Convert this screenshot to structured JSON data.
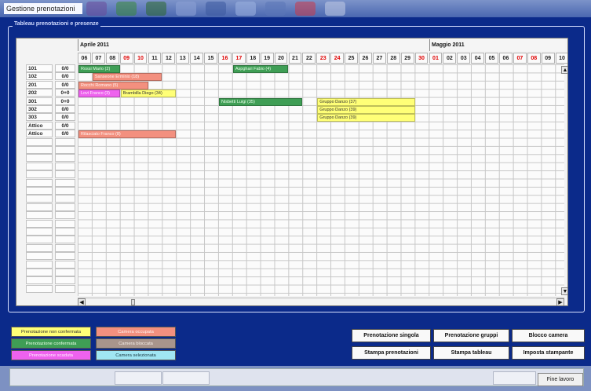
{
  "window": {
    "title": "Gestione prenotazioni"
  },
  "group": {
    "label": "Tableau prenotazioni e presenze"
  },
  "months": [
    {
      "label": "Aprile 2011"
    },
    {
      "label": "Maggio 2011"
    }
  ],
  "days": [
    {
      "n": "06",
      "red": false
    },
    {
      "n": "07",
      "red": false
    },
    {
      "n": "08",
      "red": false
    },
    {
      "n": "09",
      "red": true
    },
    {
      "n": "10",
      "red": true
    },
    {
      "n": "11",
      "red": false
    },
    {
      "n": "12",
      "red": false
    },
    {
      "n": "13",
      "red": false
    },
    {
      "n": "14",
      "red": false
    },
    {
      "n": "15",
      "red": false
    },
    {
      "n": "16",
      "red": true
    },
    {
      "n": "17",
      "red": true
    },
    {
      "n": "18",
      "red": false
    },
    {
      "n": "19",
      "red": false
    },
    {
      "n": "20",
      "red": false
    },
    {
      "n": "21",
      "red": false
    },
    {
      "n": "22",
      "red": false
    },
    {
      "n": "23",
      "red": true
    },
    {
      "n": "24",
      "red": true
    },
    {
      "n": "25",
      "red": false
    },
    {
      "n": "26",
      "red": false
    },
    {
      "n": "27",
      "red": false
    },
    {
      "n": "28",
      "red": false
    },
    {
      "n": "29",
      "red": false
    },
    {
      "n": "30",
      "red": true
    },
    {
      "n": "01",
      "red": true
    },
    {
      "n": "02",
      "red": false
    },
    {
      "n": "03",
      "red": false
    },
    {
      "n": "04",
      "red": false
    },
    {
      "n": "05",
      "red": false
    },
    {
      "n": "06",
      "red": false
    },
    {
      "n": "07",
      "red": true
    },
    {
      "n": "08",
      "red": true
    },
    {
      "n": "09",
      "red": false
    },
    {
      "n": "10",
      "red": false
    }
  ],
  "rooms": [
    {
      "name": "101",
      "status": "0/0"
    },
    {
      "name": "102",
      "status": "0/0"
    },
    {
      "name": "201",
      "status": "0/0"
    },
    {
      "name": "202",
      "status": "0+0"
    },
    {
      "name": "301",
      "status": "0+0"
    },
    {
      "name": "302",
      "status": "0/0"
    },
    {
      "name": "303",
      "status": "0/0"
    },
    {
      "name": "Attico",
      "status": "0/0"
    },
    {
      "name": "Attico",
      "status": "0/0"
    }
  ],
  "bookings": [
    {
      "label": "Rossi Mario (2)",
      "color": "green",
      "row": 0,
      "start": 0,
      "len": 3
    },
    {
      "label": "Aspghari Fabio (4)",
      "color": "green",
      "row": 0,
      "start": 11,
      "len": 4
    },
    {
      "label": "Sanseone Erminio (18)",
      "color": "salmon",
      "row": 1,
      "start": 1,
      "len": 5
    },
    {
      "label": "Rocchi Romano (5)",
      "color": "salmon",
      "row": 2,
      "start": 0,
      "len": 5
    },
    {
      "label": "Lovi Franco (3)",
      "color": "magenta",
      "row": 3,
      "start": 0,
      "len": 3
    },
    {
      "label": "Brambilla Diego (34)",
      "color": "yellow",
      "row": 3,
      "start": 3,
      "len": 4
    },
    {
      "label": "Nisbetti Luigi (35)",
      "color": "green",
      "row": 4,
      "start": 10,
      "len": 6
    },
    {
      "label": "Gruppo Danzo (37)",
      "color": "yellow",
      "row": 4,
      "start": 17,
      "len": 7
    },
    {
      "label": "Gruppo Danzo (39)",
      "color": "yellow",
      "row": 5,
      "start": 17,
      "len": 7
    },
    {
      "label": "Gruppo Danzo (39)",
      "color": "yellow",
      "row": 6,
      "start": 17,
      "len": 7
    },
    {
      "label": "Rilasciato Franco (8)",
      "color": "salmon",
      "row": 8,
      "start": 0,
      "len": 7
    }
  ],
  "legend": [
    {
      "label": "Prenotazione non confermata",
      "bg": "#ffff77",
      "fg": "#333333"
    },
    {
      "label": "Camera occupata",
      "bg": "#f3907f",
      "fg": "#fff3f0"
    },
    {
      "label": "Prenotazione confermata",
      "bg": "#3f9e55",
      "fg": "#eaffea"
    },
    {
      "label": "Camera bloccata",
      "bg": "#a8958c",
      "fg": "#f5eeea"
    },
    {
      "label": "Prenotazione scaduta",
      "bg": "#ee62ee",
      "fg": "#fff0ff"
    },
    {
      "label": "Camera selezionata",
      "bg": "#a0e6f2",
      "fg": "#1a3a44"
    }
  ],
  "buttons": {
    "single": "Prenotazione singola",
    "groups": "Prenotazione gruppi",
    "block": "Blocco camera",
    "print_bookings": "Stampa prenotazioni",
    "print_tableau": "Stampa tableau",
    "printer": "Imposta stampante",
    "end": "Fine lavoro"
  }
}
